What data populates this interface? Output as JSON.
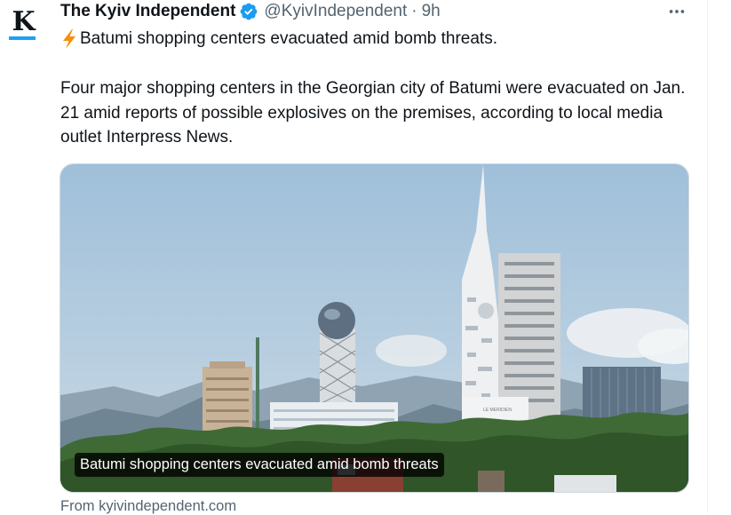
{
  "tweet": {
    "avatar_letter": "K",
    "author_name": "The Kyiv Independent",
    "handle": "@KyivIndependent",
    "separator": "·",
    "time": "9h",
    "more_icon": "more-horizontal-icon",
    "headline": "Batumi shopping centers evacuated amid bomb threats.",
    "headline_icon": "lightning-bolt-emoji",
    "body": "Four major shopping centers in the Georgian city of Batumi were evacuated on Jan. 21 amid reports of possible explosives on the premises, according to local media outlet Interpress News."
  },
  "card": {
    "caption": "Batumi shopping centers evacuated amid bomb threats",
    "source": "From kyivindependent.com",
    "building_sign": "LE MERIDIEN"
  },
  "colors": {
    "accent": "#1d9bf0",
    "text_primary": "#0f1419",
    "text_secondary": "#536471",
    "bolt": "#f4900c"
  }
}
